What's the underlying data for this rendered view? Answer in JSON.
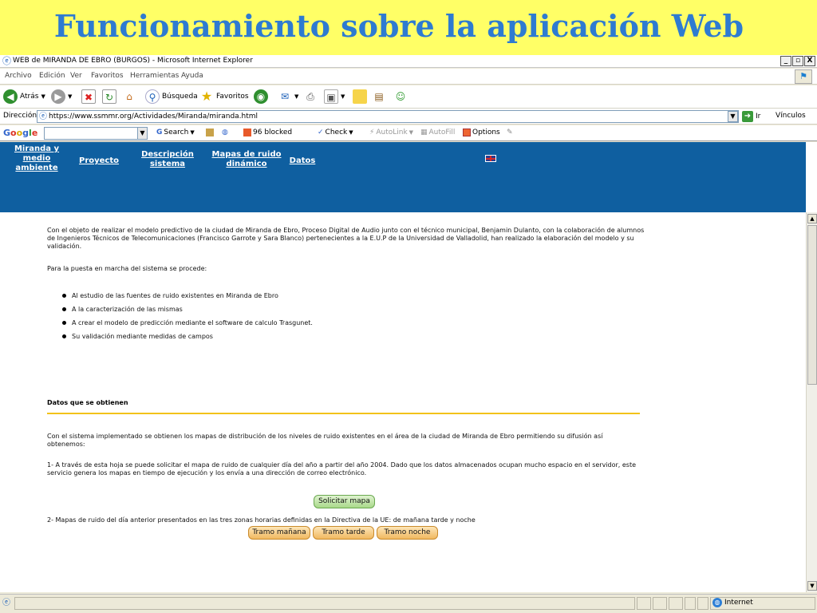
{
  "slide_title": "Funcionamiento sobre la aplicación Web",
  "window": {
    "title": "WEB de MIRANDA DE EBRO (BURGOS) - Microsoft Internet Explorer",
    "controls": [
      "_",
      "▫",
      "X"
    ]
  },
  "menubar": {
    "items": [
      "Archivo",
      "Edición",
      "Ver",
      "Favoritos",
      "Herramientas",
      "Ayuda"
    ]
  },
  "toolbar": {
    "back_label": "Atrás",
    "search_label": "Búsqueda",
    "favorites_label": "Favoritos"
  },
  "address": {
    "label": "Dirección",
    "url": "https://www.ssmmr.org/Actividades/Miranda/miranda.html",
    "go_label": "Ir",
    "links_label": "Vínculos"
  },
  "googlebar": {
    "logo": [
      "G",
      "o",
      "o",
      "g",
      "l",
      "e"
    ],
    "search_label": "Search",
    "blocked_label": "96 blocked",
    "check_label": "Check",
    "autolink_label": "AutoLink",
    "autofill_label": "AutoFill",
    "options_label": "Options"
  },
  "nav": {
    "items": [
      "Miranda y medio ambiente",
      "Proyecto",
      "Descripción sistema",
      "Mapas de ruido dinámico",
      "Datos"
    ]
  },
  "content": {
    "intro": "Con el objeto de realizar el modelo predictivo de la ciudad de Miranda de Ebro, Proceso Digital de Audio junto con el técnico municipal, Benjamin Dulanto, con la colaboración de alumnos de Ingenieros Técnicos de Telecomunicaciones (Francisco Garrote y Sara Blanco) pertenecientes a la E.U.P de la Universidad de Valladolid, han realizado la elaboración del modelo y su validación.",
    "procedure": "Para la puesta en marcha del sistema se procede:",
    "bullets": [
      "Al estudio de las fuentes de ruido existentes en Miranda de Ebro",
      "A la caracterización de las mismas",
      "A crear el modelo de predicción mediante el software de calculo Trasgunet.",
      "Su validación mediante medidas de campos"
    ],
    "section_heading": "Datos que se obtienen",
    "obtain_text": "Con el sistema implementado se obtienen los mapas de distribución de los niveles de ruido existentes en el área de la ciudad de Miranda de Ebro permitiendo su difusión así obtenemos:",
    "item1": "1- A través de esta hoja se puede solicitar el mapa de ruido de cualquier día del año a partir del año 2004. Dado que los datos almacenados ocupan mucho espacio en el servidor, este servicio genera los mapas en tiempo de ejecución y los envía a una dirección de correo electrónico.",
    "request_button": "Solicitar mapa",
    "item2": "2- Mapas de ruido del día anterior presentados en las tres zonas horarias definidas en la Directiva de la UE: de mañana tarde y noche",
    "time_buttons": [
      "Tramo mañana",
      "Tramo tarde",
      "Tramo noche"
    ]
  },
  "status": {
    "zone_label": "Internet"
  }
}
